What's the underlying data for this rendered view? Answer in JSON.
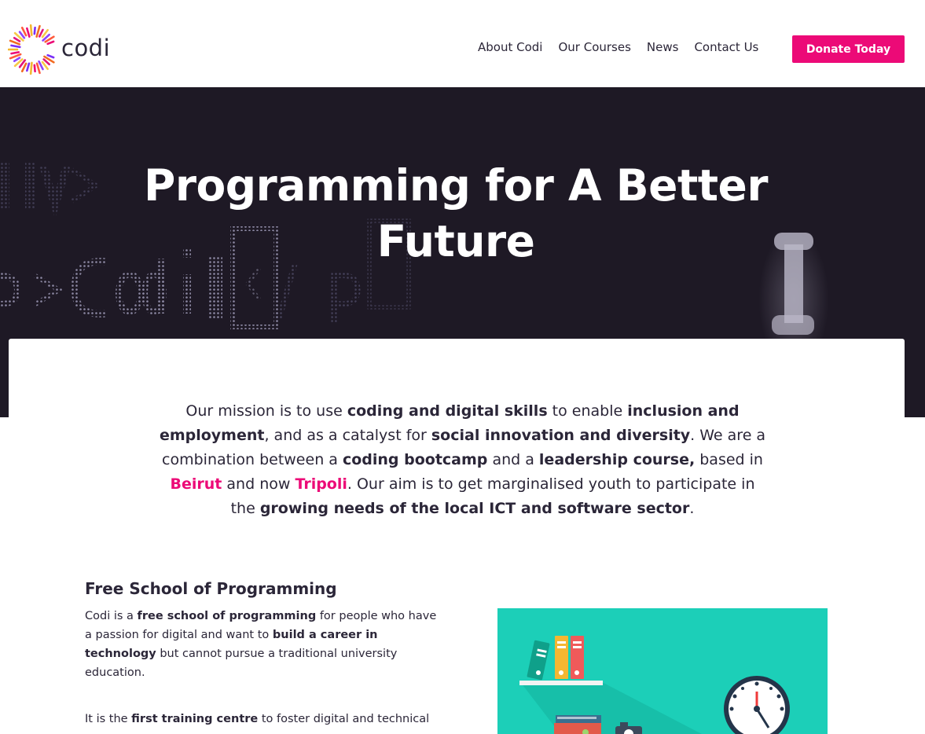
{
  "brand": {
    "name": "codi",
    "accent": "#ec0a77",
    "dark": "#1e1925"
  },
  "nav": {
    "items": [
      {
        "label": "About Codi"
      },
      {
        "label": "Our Courses"
      },
      {
        "label": "News"
      },
      {
        "label": "Contact Us"
      }
    ],
    "donate_label": "Donate Today"
  },
  "hero": {
    "title": "Programming for A Better Future",
    "background_text": "<div> <p>Codi</p>"
  },
  "mission": {
    "t1": "Our mission is to use ",
    "b1": "coding and digital skills",
    "t2": " to enable ",
    "b2": "inclusion and employment",
    "t3": ", and as a catalyst for ",
    "b3": "social innovation and diversity",
    "t4": ". We are a combination between a ",
    "b4": "coding bootcamp",
    "t5": " and a ",
    "b5": "leadership course,",
    "t6": " based in ",
    "p1": "Beirut",
    "t7": " and now ",
    "p2": "Tripoli",
    "t8": ". Our aim is to get marginalised youth to participate in the ",
    "b6": "growing needs of the local ICT and software sector",
    "t9": "."
  },
  "free_school": {
    "title": "Free School of Programming",
    "p1": {
      "t1": "Codi is a ",
      "b1": "free school of programming",
      "t2": " for people who have a passion for digital and want to ",
      "b2": "build a career in technology",
      "t3": " but cannot pursue a traditional university education."
    },
    "p2": {
      "t1": "It is the ",
      "b1": "first training centre",
      "t2": " to foster digital and technical"
    },
    "illustration_icons": [
      "bookshelf-icon",
      "clock-icon",
      "camera-icon",
      "books-icon"
    ]
  }
}
